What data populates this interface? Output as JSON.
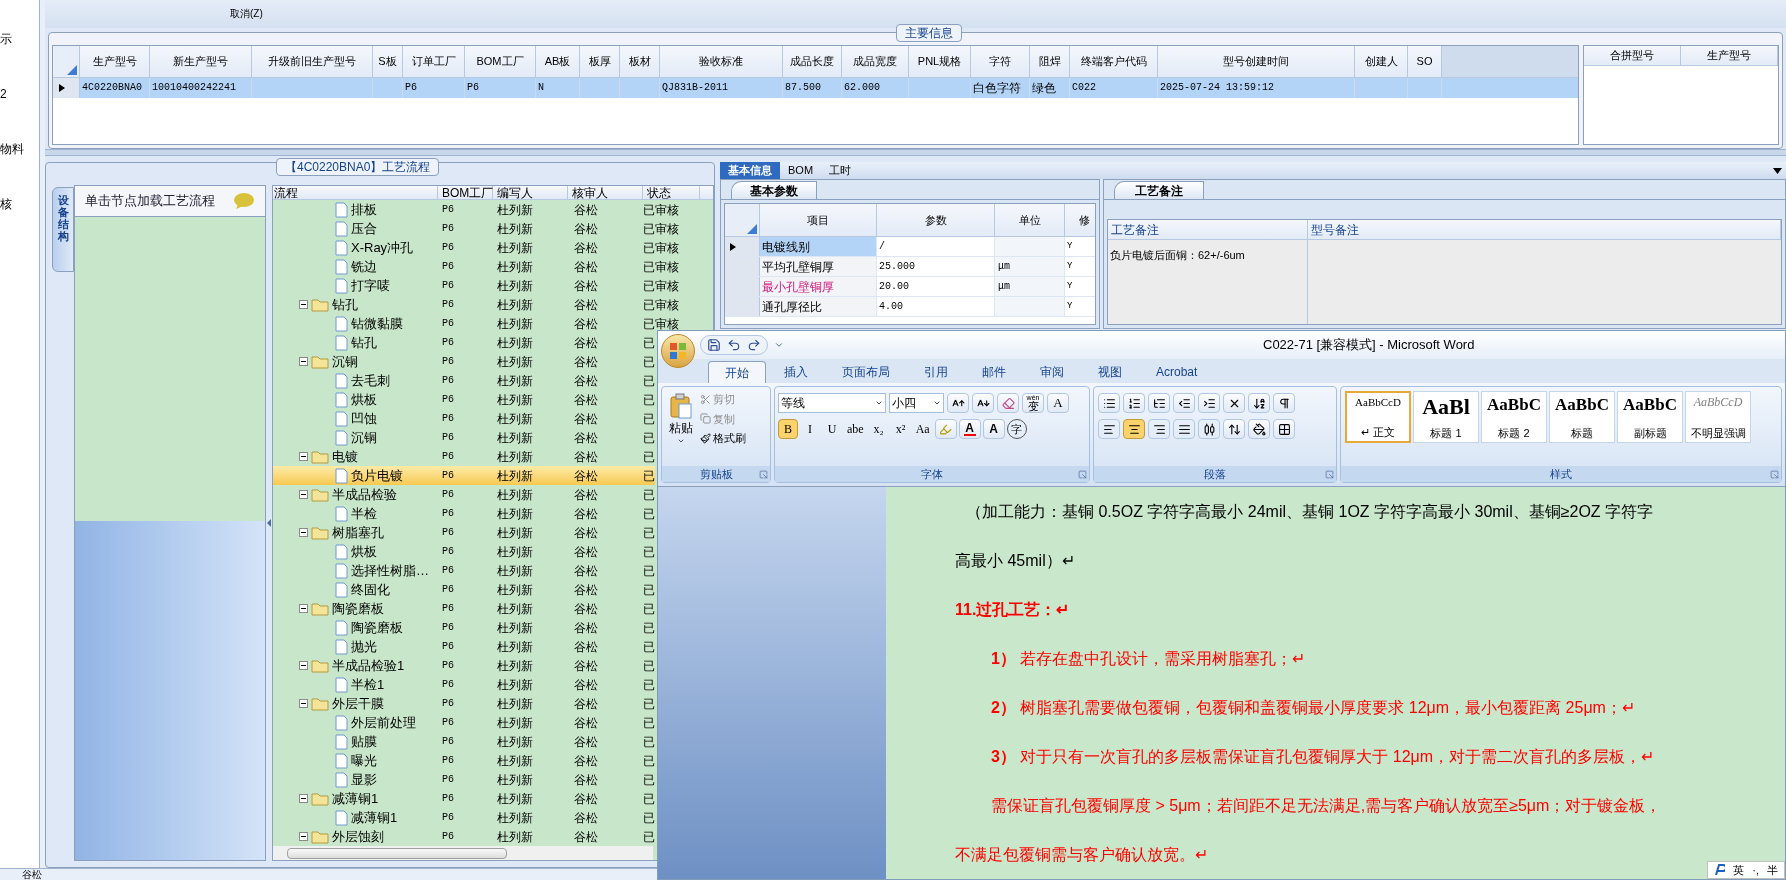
{
  "top_band": {
    "label": "取消(Z)"
  },
  "left_strip": [
    "示",
    "2",
    "物料",
    "核"
  ],
  "main_info": {
    "title": "主要信息",
    "row_selected": true,
    "columns": [
      {
        "header": "生产型号",
        "value": "4C0220BNA0"
      },
      {
        "header": "新生产型号",
        "value": "10010400242241"
      },
      {
        "header": "升级前旧生产型号"
      },
      {
        "header": "S板"
      },
      {
        "header": "订单工厂",
        "value": "P6"
      },
      {
        "header": "BOM工厂",
        "value": "P6"
      },
      {
        "header": "AB板",
        "value": "N"
      },
      {
        "header": "板厚"
      },
      {
        "header": "板材"
      },
      {
        "header": "验收标准",
        "value": "QJ831B-2011"
      },
      {
        "header": "成品长度",
        "value": "87.500"
      },
      {
        "header": "成品宽度",
        "value": "62.000"
      },
      {
        "header": "PNL规格"
      },
      {
        "header": "字符",
        "value": "白色字符"
      },
      {
        "header": "阻焊",
        "value": "绿色"
      },
      {
        "header": "终端客户代码",
        "value": "C022"
      },
      {
        "header": "型号创建时间",
        "value": "2025-07-24 13:59:12"
      },
      {
        "header": "创建人"
      },
      {
        "header": "SO"
      }
    ],
    "merge_columns": [
      "合拼型号",
      "生产型号"
    ]
  },
  "process": {
    "title": "【4C0220BNA0】工艺流程",
    "side_tab": "设备结构",
    "panel_header": "单击节点加载工艺流程",
    "columns": [
      "流程",
      "BOM工厂",
      "编写人",
      "核审人",
      "状态"
    ],
    "rows": [
      {
        "name": "排板",
        "kind": "file",
        "factory": "P6",
        "writer": "杜列新",
        "reviewer": "谷松",
        "status": "已审核",
        "selected": false
      },
      {
        "name": "压合",
        "kind": "file",
        "factory": "P6",
        "writer": "杜列新",
        "reviewer": "谷松",
        "status": "已审核",
        "selected": false
      },
      {
        "name": "X-Ray冲孔",
        "kind": "file",
        "factory": "P6",
        "writer": "杜列新",
        "reviewer": "谷松",
        "status": "已审核",
        "selected": false
      },
      {
        "name": "铣边",
        "kind": "file",
        "factory": "P6",
        "writer": "杜列新",
        "reviewer": "谷松",
        "status": "已审核",
        "selected": false
      },
      {
        "name": "打字唛",
        "kind": "file",
        "factory": "P6",
        "writer": "杜列新",
        "reviewer": "谷松",
        "status": "已审核",
        "selected": false
      },
      {
        "name": "钻孔",
        "kind": "folder",
        "expanded": true,
        "factory": "P6",
        "writer": "杜列新",
        "reviewer": "谷松",
        "status": "已审核",
        "selected": false,
        "children": [
          {
            "name": "钻微黏膜",
            "kind": "file",
            "factory": "P6",
            "writer": "杜列新",
            "reviewer": "谷松",
            "status": "已审核",
            "selected": false
          },
          {
            "name": "钻孔",
            "kind": "file",
            "factory": "P6",
            "writer": "杜列新",
            "reviewer": "谷松",
            "status": "已",
            "selected": false
          }
        ]
      },
      {
        "name": "沉铜",
        "kind": "folder",
        "expanded": true,
        "factory": "P6",
        "writer": "杜列新",
        "reviewer": "谷松",
        "status": "已",
        "selected": false,
        "children": [
          {
            "name": "去毛刺",
            "kind": "file",
            "factory": "P6",
            "writer": "杜列新",
            "reviewer": "谷松",
            "status": "已",
            "selected": false
          },
          {
            "name": "烘板",
            "kind": "file",
            "factory": "P6",
            "writer": "杜列新",
            "reviewer": "谷松",
            "status": "已",
            "selected": false
          },
          {
            "name": "凹蚀",
            "kind": "file",
            "factory": "P6",
            "writer": "杜列新",
            "reviewer": "谷松",
            "status": "已",
            "selected": false
          },
          {
            "name": "沉铜",
            "kind": "file",
            "factory": "P6",
            "writer": "杜列新",
            "reviewer": "谷松",
            "status": "已",
            "selected": false
          }
        ]
      },
      {
        "name": "电镀",
        "kind": "folder",
        "expanded": true,
        "factory": "P6",
        "writer": "杜列新",
        "reviewer": "谷松",
        "status": "已",
        "selected": false,
        "children": [
          {
            "name": "负片电镀",
            "kind": "file",
            "factory": "P6",
            "writer": "杜列新",
            "reviewer": "谷松",
            "status": "已",
            "selected": true
          }
        ]
      },
      {
        "name": "半成品检验",
        "kind": "folder",
        "expanded": true,
        "factory": "P6",
        "writer": "杜列新",
        "reviewer": "谷松",
        "status": "已",
        "selected": false,
        "children": [
          {
            "name": "半检",
            "kind": "file",
            "factory": "P6",
            "writer": "杜列新",
            "reviewer": "谷松",
            "status": "已",
            "selected": false
          }
        ]
      },
      {
        "name": "树脂塞孔",
        "kind": "folder",
        "expanded": true,
        "factory": "P6",
        "writer": "杜列新",
        "reviewer": "谷松",
        "status": "已",
        "selected": false,
        "children": [
          {
            "name": "烘板",
            "kind": "file",
            "factory": "P6",
            "writer": "杜列新",
            "reviewer": "谷松",
            "status": "已",
            "selected": false
          },
          {
            "name": "选择性树脂…",
            "kind": "file",
            "factory": "P6",
            "writer": "杜列新",
            "reviewer": "谷松",
            "status": "已",
            "selected": false
          },
          {
            "name": "终固化",
            "kind": "file",
            "factory": "P6",
            "writer": "杜列新",
            "reviewer": "谷松",
            "status": "已",
            "selected": false
          }
        ]
      },
      {
        "name": "陶瓷磨板",
        "kind": "folder",
        "expanded": true,
        "factory": "P6",
        "writer": "杜列新",
        "reviewer": "谷松",
        "status": "已",
        "selected": false,
        "children": [
          {
            "name": "陶瓷磨板",
            "kind": "file",
            "factory": "P6",
            "writer": "杜列新",
            "reviewer": "谷松",
            "status": "已",
            "selected": false
          },
          {
            "name": "抛光",
            "kind": "file",
            "factory": "P6",
            "writer": "杜列新",
            "reviewer": "谷松",
            "status": "已",
            "selected": false
          }
        ]
      },
      {
        "name": "半成品检验1",
        "kind": "folder",
        "expanded": true,
        "factory": "P6",
        "writer": "杜列新",
        "reviewer": "谷松",
        "status": "已",
        "selected": false,
        "children": [
          {
            "name": "半检1",
            "kind": "file",
            "factory": "P6",
            "writer": "杜列新",
            "reviewer": "谷松",
            "status": "已",
            "selected": false
          }
        ]
      },
      {
        "name": "外层干膜",
        "kind": "folder",
        "expanded": true,
        "factory": "P6",
        "writer": "杜列新",
        "reviewer": "谷松",
        "status": "已",
        "selected": false,
        "children": [
          {
            "name": "外层前处理",
            "kind": "file",
            "factory": "P6",
            "writer": "杜列新",
            "reviewer": "谷松",
            "status": "已",
            "selected": false
          },
          {
            "name": "贴膜",
            "kind": "file",
            "factory": "P6",
            "writer": "杜列新",
            "reviewer": "谷松",
            "status": "已",
            "selected": false
          },
          {
            "name": "曝光",
            "kind": "file",
            "factory": "P6",
            "writer": "杜列新",
            "reviewer": "谷松",
            "status": "已",
            "selected": false
          },
          {
            "name": "显影",
            "kind": "file",
            "factory": "P6",
            "writer": "杜列新",
            "reviewer": "谷松",
            "status": "已",
            "selected": false
          }
        ]
      },
      {
        "name": "减薄铜1",
        "kind": "folder",
        "expanded": true,
        "factory": "P6",
        "writer": "杜列新",
        "reviewer": "谷松",
        "status": "已",
        "selected": false,
        "children": [
          {
            "name": "减薄铜1",
            "kind": "file",
            "factory": "P6",
            "writer": "杜列新",
            "reviewer": "谷松",
            "status": "已",
            "selected": false
          }
        ]
      },
      {
        "name": "外层蚀刻",
        "kind": "folder",
        "expanded": true,
        "factory": "P6",
        "writer": "杜列新",
        "reviewer": "谷松",
        "status": "已",
        "selected": false
      }
    ]
  },
  "detail": {
    "tabs": [
      {
        "label": "基本信息",
        "selected": true
      },
      {
        "label": "BOM",
        "selected": false
      },
      {
        "label": "工时",
        "selected": false
      }
    ],
    "params": {
      "tab": "基本参数",
      "columns": [
        "项目",
        "参数",
        "单位",
        "修"
      ],
      "rows": [
        {
          "item": "电镀线别",
          "value": "/",
          "mod": "Y",
          "selected": true,
          "flagged": false
        },
        {
          "item": "平均孔壁铜厚",
          "value": "25.000",
          "unit": "μm",
          "mod": "Y",
          "selected": false,
          "flagged": false
        },
        {
          "item": "最小孔壁铜厚",
          "value": "20.00",
          "unit": "μm",
          "mod": "Y",
          "selected": false,
          "flagged": true
        },
        {
          "item": "通孔厚径比",
          "value": "4.00",
          "mod": "Y",
          "selected": false,
          "flagged": false
        }
      ]
    },
    "notes": {
      "tab": "工艺备注",
      "columns": [
        "工艺备注",
        "型号备注"
      ],
      "process_note": "负片电镀后面铜：62+/-6um"
    }
  },
  "status_bar": {
    "text": "谷松"
  },
  "word": {
    "title": "C022-71 [兼容模式] - Microsoft Word",
    "tabs": [
      {
        "label": "开始",
        "selected": true
      },
      {
        "label": "插入",
        "selected": false
      },
      {
        "label": "页面布局",
        "selected": false
      },
      {
        "label": "引用",
        "selected": false
      },
      {
        "label": "邮件",
        "selected": false
      },
      {
        "label": "审阅",
        "selected": false
      },
      {
        "label": "视图",
        "selected": false
      },
      {
        "label": "Acrobat",
        "selected": false
      }
    ],
    "clipboard": {
      "label": "剪贴板",
      "paste": "粘贴",
      "items": [
        {
          "kind": "cut",
          "label": "剪切",
          "disabled": true
        },
        {
          "kind": "copy",
          "label": "复制",
          "disabled": true
        },
        {
          "kind": "brush",
          "label": "格式刷",
          "disabled": false
        }
      ]
    },
    "font": {
      "label": "字体",
      "name": "等线",
      "size": "小四",
      "phonetic_hint": "wén",
      "phonetic": "变",
      "border_char": "A",
      "buttons": [
        {
          "label": "B",
          "selected": true
        },
        {
          "label": "I",
          "selected": false
        },
        {
          "label": "U",
          "selected": false
        },
        {
          "label": "abe",
          "selected": false
        },
        {
          "label": "x₂",
          "selected": false
        },
        {
          "label": "x²",
          "selected": false
        },
        {
          "label": "Aa",
          "selected": false
        }
      ],
      "color_char": "A",
      "shade_char": "A",
      "enclose_char": "字"
    },
    "paragraph": {
      "label": "段落",
      "aligns": [
        {
          "kind": "left",
          "selected": false
        },
        {
          "kind": "center",
          "selected": true
        },
        {
          "kind": "right",
          "selected": false
        },
        {
          "kind": "justify",
          "selected": false
        },
        {
          "kind": "distributed",
          "selected": false
        }
      ]
    },
    "styles": {
      "label": "样式",
      "items": [
        {
          "preview": "AaBbCcD",
          "name": "↵ 正文",
          "kind": "normal",
          "selected": true
        },
        {
          "preview": "AaBl",
          "name": "标题 1",
          "kind": "h1",
          "selected": false
        },
        {
          "preview": "AaBbC",
          "name": "标题 2",
          "kind": "h2",
          "selected": false
        },
        {
          "preview": "AaBbC",
          "name": "标题",
          "kind": "title",
          "selected": false
        },
        {
          "preview": "AaBbC",
          "name": "副标题",
          "kind": "subtitle",
          "selected": false
        },
        {
          "preview": "AaBbCcD",
          "name": "不明显强调",
          "kind": "subtle",
          "selected": false
        }
      ]
    },
    "lines": [
      {
        "kind": "plain",
        "text": "（加工能力：基铜 0.5OZ 字符字高最小 24mil、基铜 1OZ 字符字高最小 30mil、基铜≥2OZ 字符字"
      },
      {
        "kind": "plain_wrap",
        "text": "高最小 45mil）↵"
      },
      {
        "kind": "heading",
        "text": "11.过孔工艺：↵"
      },
      {
        "kind": "item",
        "text": "**1）** 若存在盘中孔设计，需采用树脂塞孔；↵"
      },
      {
        "kind": "item",
        "text": "**2）** 树脂塞孔需要做包覆铜，包覆铜和盖覆铜最小厚度要求 12μm，最小包覆距离 25μm；↵"
      },
      {
        "kind": "item",
        "text": "**3）** 对于只有一次盲孔的多层板需保证盲孔包覆铜厚大于 12μm，对于需二次盲孔的多层板，↵"
      },
      {
        "kind": "item",
        "text": "需保证盲孔包覆铜厚度 > 5μm；若间距不足无法满足,需与客户确认放宽至≥5μm；对于镀金板，"
      },
      {
        "kind": "item_wrap",
        "text": "不满足包覆铜需与客户确认放宽。↵"
      }
    ],
    "ime": [
      "英",
      "·,",
      "半"
    ]
  }
}
